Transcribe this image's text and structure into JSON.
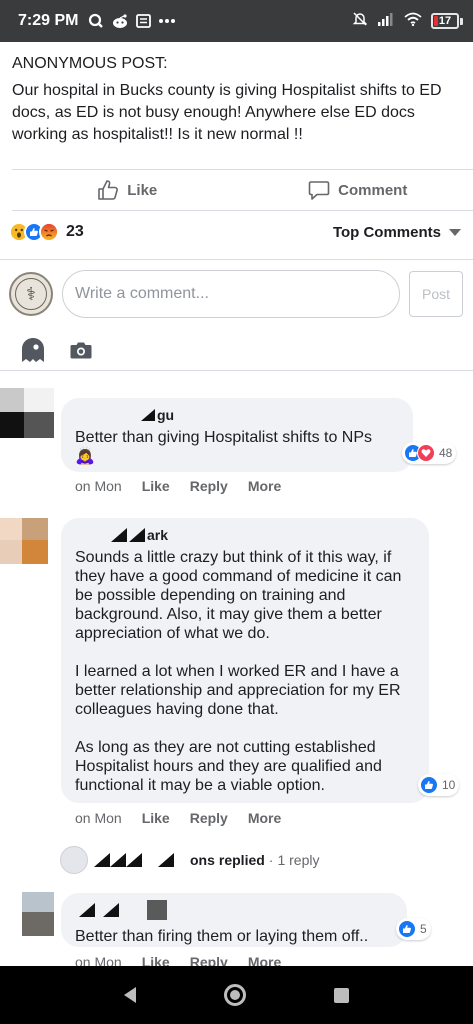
{
  "status_bar": {
    "time": "7:29 PM",
    "battery": "17",
    "battery_level": 0.17,
    "icons": [
      "q-app-icon",
      "reddit-icon",
      "message-icon",
      "more-dots-icon",
      "mute-icon",
      "signal-icon",
      "wifi-icon",
      "battery-icon"
    ]
  },
  "post": {
    "label": "ANONYMOUS POST:",
    "body": "Our hospital in Bucks county is giving Hospitalist shifts to ED docs, as ED is not busy enough! Anywhere else ED docs working as hospitalist!! Is it new normal !!"
  },
  "actions": {
    "like_label": "Like",
    "comment_label": "Comment"
  },
  "reactions": {
    "count": "23",
    "types": [
      "wow",
      "like",
      "angry"
    ],
    "sort_label": "Top Comments"
  },
  "composer": {
    "placeholder": "Write a comment...",
    "post_label": "Post"
  },
  "comments": [
    {
      "name_suffix": "gu",
      "text": "Better than giving Hospitalist shifts to NPs",
      "emoji": "🙇‍♀️",
      "time": "on Mon",
      "like_label": "Like",
      "reply_label": "Reply",
      "more_label": "More",
      "reaction_count": "48"
    },
    {
      "name_suffix": "ark",
      "text": "Sounds a little crazy but think of it this way, if they have a good command of medicine it can be possible depending on training and background. Also, it may give them a better appreciation of what we do.\n\nI learned a lot when I worked ER and I have a better relationship and appreciation for my ER colleagues having done that.\n\nAs long as they are not cutting established Hospitalist hours and they are qualified and functional it may be a viable option.",
      "time": "on Mon",
      "like_label": "Like",
      "reply_label": "Reply",
      "more_label": "More",
      "reaction_count": "10"
    },
    {
      "text": "Better than firing them or laying them off..",
      "time": "on Mon",
      "like_label": "Like",
      "reply_label": "Reply",
      "more_label": "More",
      "reaction_count": "5"
    }
  ],
  "replies": {
    "name_suffix": "ons",
    "replied_label": "replied",
    "separator": "·",
    "count_label": "1 reply"
  },
  "colors": {
    "status_bar_bg": "#3a3b3c",
    "bubble_bg": "#f0f2f5",
    "accent_blue": "#1877f2",
    "love_red": "#f33e58",
    "muted_text": "#65676b"
  }
}
